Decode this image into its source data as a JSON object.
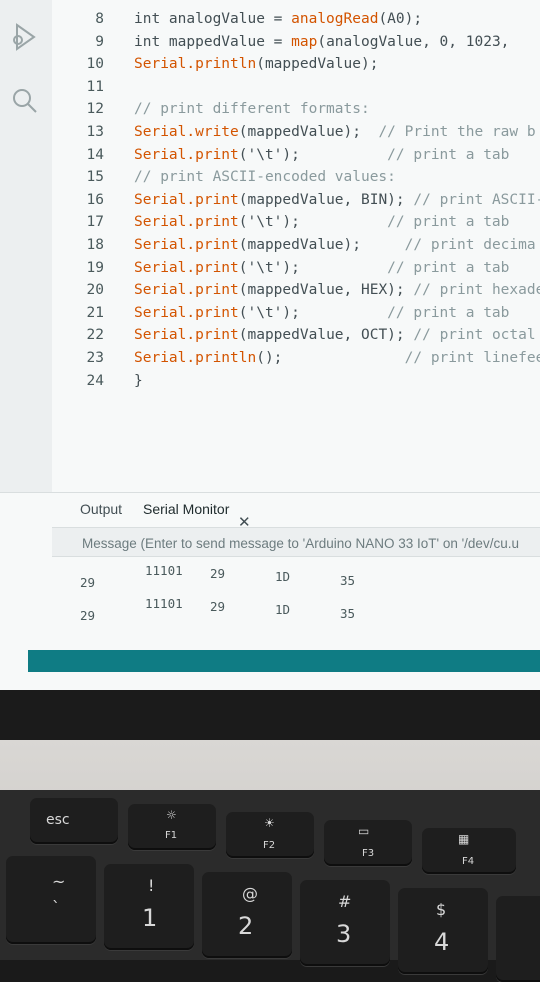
{
  "editor": {
    "lines": [
      {
        "n": "8",
        "parts": [
          [
            "kw",
            "int analogValue = "
          ],
          [
            "fn",
            "analogRead"
          ],
          [
            "tx",
            "(A0);"
          ]
        ]
      },
      {
        "n": "9",
        "parts": [
          [
            "kw",
            "int mappedValue = "
          ],
          [
            "fn",
            "map"
          ],
          [
            "tx",
            "(analogValue, 0, 1023, "
          ]
        ]
      },
      {
        "n": "10",
        "parts": [
          [
            "fn",
            "Serial.println"
          ],
          [
            "tx",
            "(mappedValue);"
          ]
        ]
      },
      {
        "n": "11",
        "parts": []
      },
      {
        "n": "12",
        "parts": [
          [
            "cm",
            "// print different formats:"
          ]
        ]
      },
      {
        "n": "13",
        "parts": [
          [
            "fn",
            "Serial.write"
          ],
          [
            "tx",
            "(mappedValue);  "
          ],
          [
            "cm",
            "// Print the raw b"
          ]
        ]
      },
      {
        "n": "14",
        "parts": [
          [
            "fn",
            "Serial.print"
          ],
          [
            "tx",
            "('\\t');          "
          ],
          [
            "cm",
            "// print a tab"
          ]
        ]
      },
      {
        "n": "15",
        "parts": [
          [
            "cm",
            "// print ASCII-encoded values:"
          ]
        ]
      },
      {
        "n": "16",
        "parts": [
          [
            "fn",
            "Serial.print"
          ],
          [
            "tx",
            "(mappedValue, BIN); "
          ],
          [
            "cm",
            "// print ASCII-"
          ]
        ]
      },
      {
        "n": "17",
        "parts": [
          [
            "fn",
            "Serial.print"
          ],
          [
            "tx",
            "('\\t');          "
          ],
          [
            "cm",
            "// print a tab"
          ]
        ]
      },
      {
        "n": "18",
        "parts": [
          [
            "fn",
            "Serial.print"
          ],
          [
            "tx",
            "(mappedValue);     "
          ],
          [
            "cm",
            "// print decima"
          ]
        ]
      },
      {
        "n": "19",
        "parts": [
          [
            "fn",
            "Serial.print"
          ],
          [
            "tx",
            "('\\t');          "
          ],
          [
            "cm",
            "// print a tab"
          ]
        ]
      },
      {
        "n": "20",
        "parts": [
          [
            "fn",
            "Serial.print"
          ],
          [
            "tx",
            "(mappedValue, HEX); "
          ],
          [
            "cm",
            "// print hexadec"
          ]
        ]
      },
      {
        "n": "21",
        "parts": [
          [
            "fn",
            "Serial.print"
          ],
          [
            "tx",
            "('\\t');          "
          ],
          [
            "cm",
            "// print a tab"
          ]
        ]
      },
      {
        "n": "22",
        "parts": [
          [
            "fn",
            "Serial.print"
          ],
          [
            "tx",
            "(mappedValue, OCT); "
          ],
          [
            "cm",
            "// print octal v"
          ]
        ]
      },
      {
        "n": "23",
        "parts": [
          [
            "fn",
            "Serial.println"
          ],
          [
            "tx",
            "();              "
          ],
          [
            "cm",
            "// print linefeed"
          ]
        ]
      },
      {
        "n": "24",
        "parts": [
          [
            "tx",
            "}"
          ]
        ]
      }
    ]
  },
  "panel": {
    "tab_output": "Output",
    "tab_serial": "Serial Monitor",
    "close_glyph": "✕",
    "message_placeholder": "Message (Enter to send message to 'Arduino NANO 33 IoT' on '/dev/cu.u",
    "rows": [
      {
        "a": "29",
        "b": "11101",
        "c": "29",
        "d": "1D",
        "e": "35"
      },
      {
        "a": "29",
        "b": "11101",
        "c": "29",
        "d": "1D",
        "e": "35"
      }
    ]
  },
  "keyboard": {
    "esc": "esc",
    "f1": "F1",
    "f2": "F2",
    "f3": "F3",
    "f4": "F4",
    "tilde_top": "~",
    "tilde_bottom": "`",
    "k1_top": "!",
    "k1": "1",
    "k2_top": "@",
    "k2": "2",
    "k3_top": "#",
    "k3": "3",
    "k4_top": "$",
    "k4": "4"
  },
  "colors": {
    "accent": "#0f7c84",
    "function_name": "#d35400",
    "comment": "#8a9a9d"
  }
}
